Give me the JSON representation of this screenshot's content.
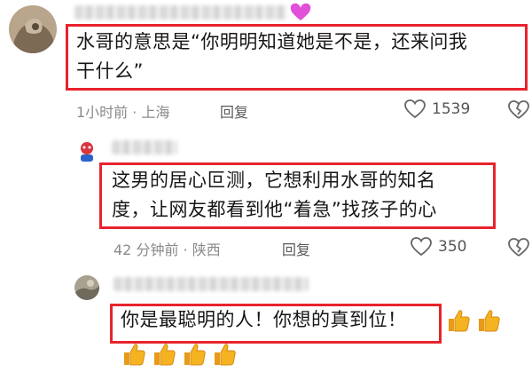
{
  "comments": [
    {
      "text_lines": [
        "水哥的意思是“你明明知道她是不是，还来问我",
        "干什么”"
      ],
      "time": "1小时前",
      "location": "上海",
      "reply_label": "回复",
      "likes": "1539",
      "heart_badge": true
    },
    {
      "text_lines": [
        "这男的居心叵测，它想利用水哥的知名",
        "度，让网友都看到他“着急”找孩子的心"
      ],
      "time": "42 分钟前",
      "location": "陕西",
      "reply_label": "回复",
      "likes": "350"
    },
    {
      "text_lines": [
        "你是最聪明的人！你想的真到位！"
      ],
      "emoji_name": "thumbs-up"
    }
  ],
  "separator": " · ",
  "colors": {
    "highlight_box": "#e8232d",
    "heart": "#e24fd8",
    "thumb": "#f5b321"
  }
}
